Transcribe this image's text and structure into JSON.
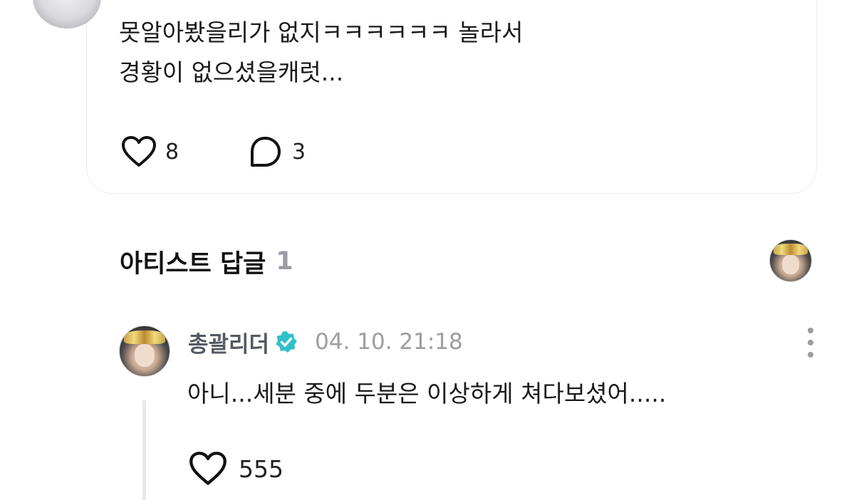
{
  "post": {
    "text_lines": [
      "못알아봤을리가 없지ㅋㅋㅋㅋㅋㅋ 놀라서",
      "경황이 없으셨을캐럿..."
    ],
    "like_count": "8",
    "comment_count": "3"
  },
  "artist_replies": {
    "title": "아티스트 답글",
    "count": "1"
  },
  "reply": {
    "author": "총괄리더",
    "timestamp": "04. 10. 21:18",
    "text": "아니...세분 중에 두분은 이상하게 쳐다보셨어.....",
    "like_count": "555"
  },
  "colors": {
    "verified_badge": "#2fc0cc",
    "muted_text": "#9c9ca4",
    "author_name": "#555a63"
  },
  "icons": [
    "heart-icon",
    "comment-bubble-icon",
    "verified-badge-icon",
    "more-vertical-icon"
  ]
}
